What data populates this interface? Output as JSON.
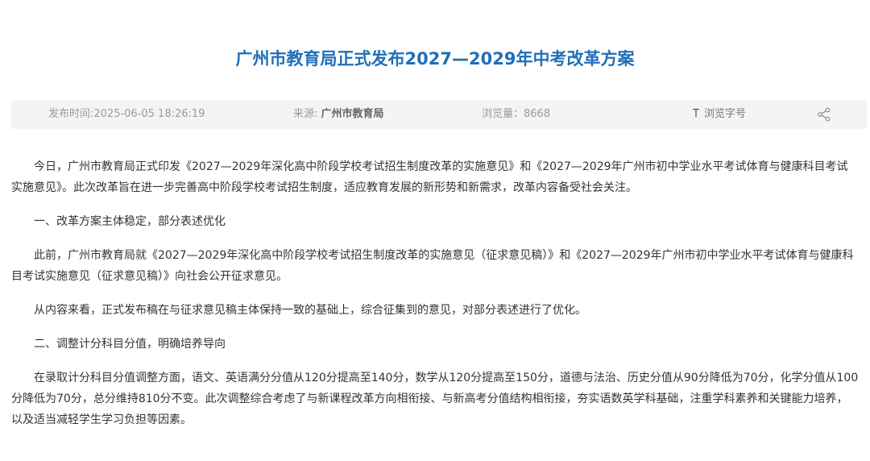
{
  "article": {
    "title": "广州市教育局正式发布2027—2029年中考改革方案",
    "meta": {
      "publish_time": "发布时间:2025-06-05 18:26:19",
      "source_label": "来源: ",
      "source_name": "广州市教育局",
      "views": "浏览量：8668",
      "font_size_icon": "T",
      "font_size_label": "浏览字号"
    },
    "paragraphs": [
      "今日，广州市教育局正式印发《2027—2029年深化高中阶段学校考试招生制度改革的实施意见》和《2027—2029年广州市初中学业水平考试体育与健康科目考试实施意见》。此次改革旨在进一步完善高中阶段学校考试招生制度，适应教育发展的新形势和新需求，改革内容备受社会关注。",
      "一、改革方案主体稳定，部分表述优化",
      "此前，广州市教育局就《2027—2029年深化高中阶段学校考试招生制度改革的实施意见（征求意见稿）》和《2027—2029年广州市初中学业水平考试体育与健康科目考试实施意见（征求意见稿）》向社会公开征求意见。",
      "从内容来看，正式发布稿在与征求意见稿主体保持一致的基础上，综合征集到的意见，对部分表述进行了优化。",
      "二、调整计分科目分值，明确培养导向",
      "在录取计分科目分值调整方面，语文、英语满分分值从120分提高至140分，数学从120分提高至150分，道德与法治、历史分值从90分降低为70分，化学分值从100分降低为70分，总分维持810分不变。此次调整综合考虑了与新课程改革方向相衔接、与新高考分值结构相衔接，夯实语数英学科基础，注重学科素养和关键能力培养，以及适当减轻学生学习负担等因素。"
    ],
    "colors": {
      "title": "#1f6fb8",
      "meta_bg": "#f4f4f4",
      "meta_text": "#9a9a9a",
      "body_text": "#333333"
    },
    "icons": {
      "share": "share-icon"
    }
  }
}
